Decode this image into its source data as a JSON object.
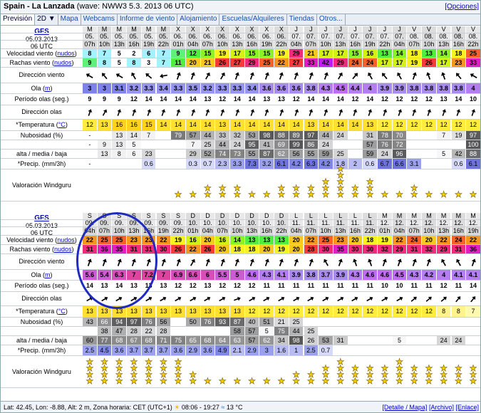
{
  "header": {
    "title": "Spain - La Lanzada",
    "subtitle": "(wave: NWW3 5.3. 2013 06 UTC)",
    "options_link": "[Opciones]"
  },
  "tabs": [
    "Previsión",
    "2D ▼",
    "Mapa",
    "Webcams",
    "Informe de viento",
    "Alojamiento",
    "Escuelas/Alquileres",
    "Tiendas",
    "Otros..."
  ],
  "labels": {
    "model": "GFS",
    "wind": "Velocidad viento (",
    "gusts": "Rachas viento (",
    "units_knots": "nudos",
    "wind_dir": "Dirección viento",
    "wave": "Ola (",
    "units_m": "m",
    "period": "Período olas (seg.)",
    "wave_dir": "Dirección olas",
    "temp": "*Temperatura (",
    "units_c": "°C",
    "cloud1": "Nubosidad (%)",
    "cloud2": "alta / media / baja",
    "precip": "*Precip. (mm/3h)",
    "rating": "Valoración Windguru"
  },
  "blocks": [
    {
      "date": "05.03.2013",
      "utc": "06 UTC",
      "days": [
        "M",
        "M",
        "M",
        "M",
        "M",
        "M",
        "X",
        "X",
        "X",
        "X",
        "X",
        "X",
        "X",
        "X",
        "J",
        "J",
        "J",
        "J",
        "J",
        "J",
        "J",
        "J",
        "V",
        "V",
        "V",
        "V",
        "V"
      ],
      "dates": [
        "05.",
        "05.",
        "05.",
        "05.",
        "05.",
        "05.",
        "06.",
        "06.",
        "06.",
        "06.",
        "06.",
        "06.",
        "06.",
        "06.",
        "07.",
        "07.",
        "07.",
        "07.",
        "07.",
        "07.",
        "07.",
        "07.",
        "08.",
        "08.",
        "08.",
        "08.",
        "08."
      ],
      "hours": [
        "07h",
        "10h",
        "13h",
        "16h",
        "19h",
        "22h",
        "01h",
        "04h",
        "07h",
        "10h",
        "13h",
        "16h",
        "19h",
        "22h",
        "04h",
        "07h",
        "10h",
        "13h",
        "16h",
        "19h",
        "22h",
        "04h",
        "07h",
        "10h",
        "13h",
        "16h",
        "22h"
      ],
      "wind": [
        8,
        7,
        5,
        2,
        6,
        7,
        9,
        12,
        15,
        19,
        17,
        15,
        15,
        19,
        29,
        21,
        17,
        17,
        15,
        16,
        13,
        14,
        18,
        13,
        14,
        18,
        25
      ],
      "gusts": [
        9,
        8,
        5,
        8,
        3,
        7,
        11,
        20,
        21,
        26,
        27,
        29,
        25,
        22,
        27,
        33,
        42,
        29,
        24,
        24,
        17,
        17,
        19,
        26,
        17,
        23,
        33
      ],
      "wind_dir_deg": [
        300,
        320,
        300,
        330,
        310,
        260,
        20,
        20,
        30,
        30,
        20,
        20,
        20,
        20,
        20,
        20,
        20,
        30,
        40,
        330,
        320,
        330,
        20,
        340,
        340,
        320,
        300
      ],
      "wave": [
        3,
        3,
        3.1,
        3.2,
        3.3,
        3.4,
        3.3,
        3.5,
        3.2,
        3.3,
        3.3,
        3.4,
        3.6,
        3.6,
        3.6,
        3.8,
        4.3,
        4.5,
        4.4,
        4,
        3.9,
        3.9,
        3.8,
        3.8,
        3.8,
        3.8,
        4
      ],
      "period": [
        9,
        9,
        9,
        12,
        14,
        14,
        14,
        14,
        13,
        12,
        14,
        14,
        13,
        13,
        12,
        14,
        14,
        14,
        12,
        14,
        12,
        12,
        12,
        12,
        13,
        14,
        10
      ],
      "wave_dir_deg": [
        20,
        30,
        20,
        20,
        20,
        20,
        20,
        20,
        20,
        20,
        20,
        20,
        20,
        20,
        20,
        20,
        20,
        20,
        20,
        20,
        20,
        20,
        20,
        20,
        20,
        20,
        20
      ],
      "temp": [
        12,
        13,
        16,
        16,
        15,
        14,
        14,
        14,
        14,
        13,
        14,
        14,
        14,
        14,
        14,
        13,
        14,
        14,
        14,
        13,
        12,
        12,
        12,
        12,
        12,
        12,
        12
      ],
      "cloud_high": [
        "-",
        "",
        "13",
        "14",
        "7",
        "",
        "79",
        "57",
        "44",
        "33",
        "32",
        "53",
        "98",
        "88",
        "89",
        "97",
        "44",
        "24",
        "",
        "31",
        "78",
        "70",
        "",
        "",
        "7",
        "19",
        "97"
      ],
      "cloud_mid": [
        "-",
        "9",
        "13",
        "5",
        "",
        "",
        "",
        "7",
        "25",
        "44",
        "24",
        "95",
        "41",
        "69",
        "99",
        "86",
        "24",
        "",
        "",
        "57",
        "76",
        "72",
        "",
        "",
        "",
        "",
        "100"
      ],
      "cloud_low": [
        "",
        "13",
        "8",
        "6",
        "23",
        "",
        "",
        "29",
        "52",
        "74",
        "73",
        "55",
        "87",
        "62",
        "56",
        "55",
        "59",
        "25",
        "",
        "59",
        "24",
        "96",
        "",
        "",
        "5",
        "42",
        "88"
      ],
      "precip": [
        "-",
        "",
        "",
        "",
        "0.6",
        "",
        "",
        "0.3",
        "0.7",
        "2.3",
        "3.3",
        "7.3",
        "3.2",
        "6.1",
        "4.2",
        "6.3",
        "4.2",
        "1.8",
        "2",
        "0.6",
        "6.7",
        "6.6",
        "3.1",
        "",
        "",
        "0.6",
        "6.1"
      ],
      "stars": [
        0,
        0,
        0,
        0,
        0,
        0,
        1,
        1,
        2,
        2,
        2,
        1,
        1,
        2,
        2,
        2,
        3,
        5,
        2,
        3,
        1,
        1,
        2,
        1,
        1,
        1,
        1
      ]
    },
    {
      "date": "05.03.2013",
      "utc": "06 UTC",
      "days": [
        "S",
        "S",
        "S",
        "S",
        "S",
        "S",
        "S",
        "D",
        "D",
        "D",
        "D",
        "D",
        "D",
        "D",
        "L",
        "L",
        "L",
        "L",
        "L",
        "L",
        "M",
        "M",
        "M",
        "M",
        "M",
        "M",
        "M"
      ],
      "dates": [
        "09.",
        "09.",
        "09.",
        "09.",
        "09.",
        "09.",
        "09.",
        "10.",
        "10.",
        "10.",
        "10.",
        "10.",
        "10.",
        "10.",
        "11.",
        "11.",
        "11.",
        "11.",
        "11.",
        "11.",
        "12.",
        "12.",
        "12.",
        "12.",
        "12.",
        "12.",
        "12."
      ],
      "hours": [
        "04h",
        "07h",
        "10h",
        "13h",
        "16h",
        "19h",
        "22h",
        "01h",
        "04h",
        "07h",
        "10h",
        "13h",
        "16h",
        "22h",
        "04h",
        "07h",
        "10h",
        "13h",
        "16h",
        "22h",
        "01h",
        "04h",
        "07h",
        "10h",
        "13h",
        "16h",
        "19h"
      ],
      "wind": [
        22,
        25,
        25,
        23,
        23,
        22,
        19,
        16,
        20,
        16,
        14,
        13,
        13,
        13,
        20,
        22,
        25,
        23,
        20,
        18,
        19,
        22,
        24,
        20,
        22,
        24,
        22
      ],
      "gusts": [
        31,
        36,
        35,
        31,
        31,
        30,
        26,
        22,
        26,
        20,
        18,
        18,
        20,
        19,
        20,
        28,
        30,
        35,
        30,
        30,
        32,
        29,
        31,
        32,
        29,
        31,
        36
      ],
      "wind_dir_deg": [
        20,
        20,
        20,
        20,
        20,
        20,
        20,
        30,
        20,
        20,
        20,
        20,
        20,
        20,
        20,
        20,
        330,
        20,
        340,
        340,
        20,
        20,
        20,
        20,
        330,
        330,
        20
      ],
      "wave": [
        5.6,
        5.4,
        6.3,
        7,
        7.2,
        7,
        6.9,
        6.6,
        6,
        5.5,
        5,
        4.6,
        4.3,
        4.1,
        3.9,
        3.8,
        3.7,
        3.9,
        4.3,
        4.6,
        4.6,
        4.5,
        4.3,
        4.2,
        4,
        4.1,
        4.1
      ],
      "period": [
        14,
        13,
        14,
        13,
        13,
        13,
        12,
        12,
        13,
        12,
        12,
        12,
        11,
        11,
        11,
        11,
        11,
        11,
        11,
        11,
        10,
        10,
        11,
        11,
        12,
        11,
        14
      ],
      "wave_dir_deg": [
        60,
        60,
        60,
        60,
        60,
        60,
        60,
        60,
        60,
        60,
        70,
        60,
        60,
        60,
        60,
        60,
        60,
        60,
        60,
        60,
        60,
        60,
        50,
        50,
        50,
        40,
        40
      ],
      "temp": [
        13,
        13,
        13,
        13,
        13,
        13,
        13,
        13,
        13,
        13,
        13,
        12,
        12,
        12,
        12,
        12,
        12,
        12,
        12,
        12,
        12,
        12,
        12,
        12,
        8,
        8,
        7
      ],
      "cloud_high": [
        "43",
        "66",
        "94",
        "97",
        "76",
        "56",
        "",
        "50",
        "76",
        "93",
        "87",
        "40",
        "51",
        "21",
        "25",
        "",
        "",
        "",
        "",
        "",
        "",
        "",
        "",
        "",
        "",
        "",
        ""
      ],
      "cloud_mid": [
        "",
        "38",
        "47",
        "28",
        "22",
        "28",
        "",
        "",
        "",
        "",
        "58",
        "57",
        "5",
        "75",
        "44",
        "25",
        "",
        "",
        "",
        "",
        "",
        "",
        "",
        "",
        "",
        "",
        ""
      ],
      "cloud_low": [
        "60",
        "77",
        "68",
        "67",
        "68",
        "71",
        "75",
        "65",
        "68",
        "64",
        "63",
        "57",
        "62",
        "34",
        "98",
        "26",
        "53",
        "31",
        "",
        "",
        "",
        "5",
        "",
        "",
        "24",
        "24",
        ""
      ],
      "precip": [
        "2.5",
        "4.5",
        "3.6",
        "3.7",
        "3.7",
        "3.7",
        "3.6",
        "2.9",
        "3.6",
        "4.9",
        "2.1",
        "2.9",
        "3",
        "1.6",
        "1",
        "2.5",
        "0.7",
        "",
        "",
        "",
        "",
        "",
        "",
        "",
        "",
        "",
        ""
      ],
      "stars": [
        4,
        4,
        4,
        4,
        4,
        4,
        4,
        2,
        1,
        1,
        1,
        1,
        1,
        1,
        2,
        2,
        3,
        4,
        3,
        3,
        3,
        4,
        3,
        3,
        3,
        3,
        3
      ]
    }
  ],
  "footer": {
    "lat": "Lat: 42.45, Lon: -8.88, Alt: 2 m, Zona horaria: CET (UTC+1)",
    "sun": "08:06 - 19:27",
    "sea_temp": "13 °C",
    "links": [
      "[Detalle / Mapa]",
      "[Archivo]",
      "[Enlace]"
    ]
  },
  "colors": {
    "accent": "#1a4ea8",
    "circle": "#1f2bbf"
  }
}
